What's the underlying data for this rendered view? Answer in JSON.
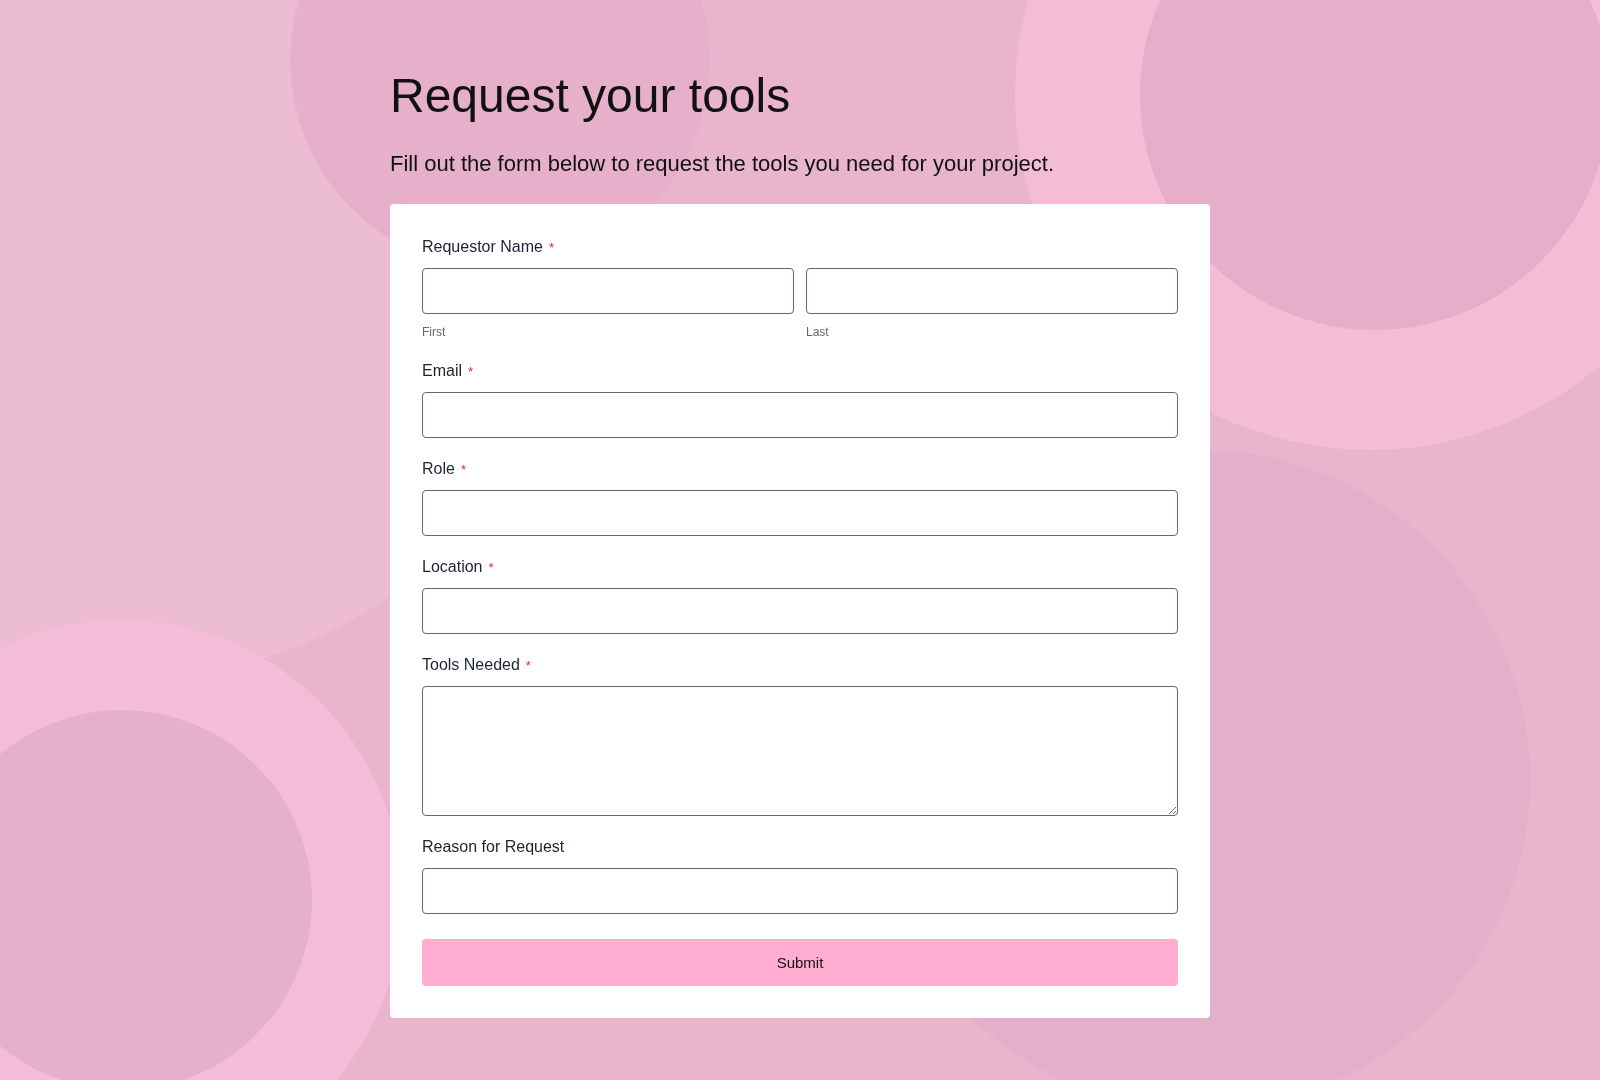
{
  "title": "Request your tools",
  "subtitle": "Fill out the form below to request the tools you need for your project.",
  "fields": [
    {
      "kind": "name",
      "label": "Requestor Name",
      "required_mark": "*",
      "sublabels": [
        "First",
        "Last"
      ]
    },
    {
      "kind": "text",
      "label": "Email",
      "required_mark": "*"
    },
    {
      "kind": "text",
      "label": "Role",
      "required_mark": "*"
    },
    {
      "kind": "text",
      "label": "Location",
      "required_mark": "*"
    },
    {
      "kind": "textarea",
      "label": "Tools Needed",
      "required_mark": "*"
    },
    {
      "kind": "text",
      "label": "Reason for Request"
    }
  ],
  "submit": "Submit"
}
